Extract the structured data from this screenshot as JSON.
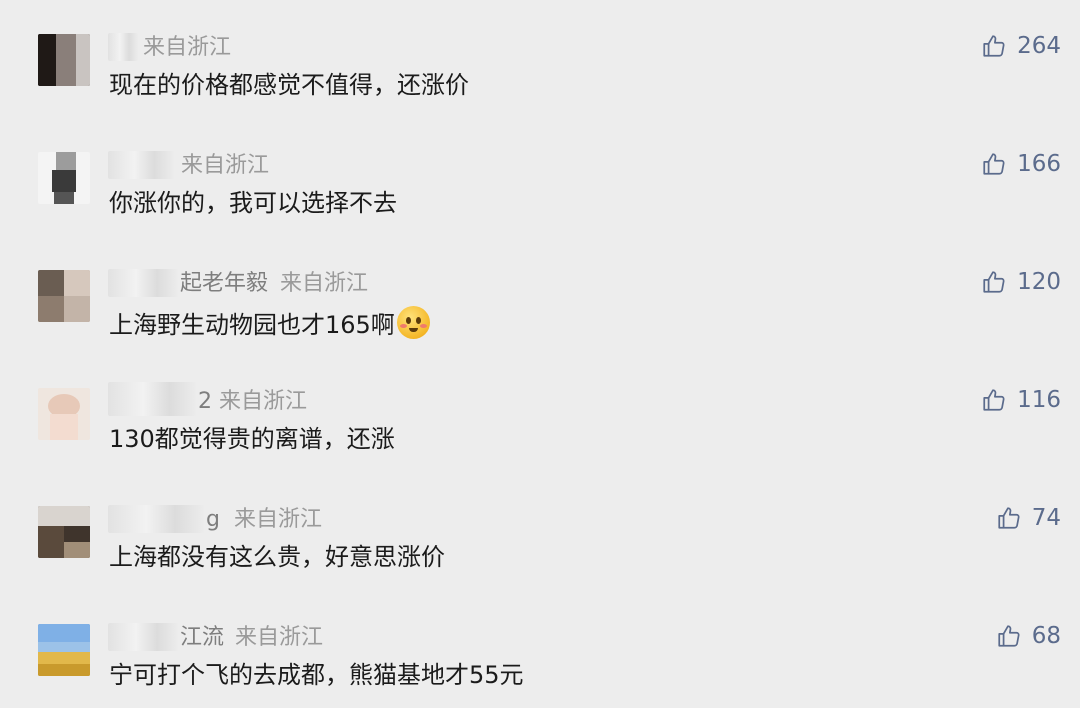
{
  "comments": [
    {
      "name_tail": "",
      "location": "来自浙江",
      "text": "现在的价格都感觉不值得，还涨价",
      "likes": "264",
      "emoji": false
    },
    {
      "name_tail": "",
      "location": "来自浙江",
      "text": "你涨你的，我可以选择不去",
      "likes": "166",
      "emoji": false
    },
    {
      "name_tail": "起老年毅",
      "location": "来自浙江",
      "text": "上海野生动物园也才165啊",
      "likes": "120",
      "emoji": true
    },
    {
      "name_tail": "2",
      "location": "来自浙江",
      "text": "130都觉得贵的离谱，还涨",
      "likes": "116",
      "emoji": false
    },
    {
      "name_tail": "g",
      "location": "来自浙江",
      "text": "上海都没有这么贵，好意思涨价",
      "likes": "74",
      "emoji": false
    },
    {
      "name_tail": "江流",
      "location": "来自浙江",
      "text": "宁可打个飞的去成都，熊猫基地才55元",
      "likes": "68",
      "emoji": false
    }
  ],
  "icons": {
    "like": "thumbs-up-icon"
  },
  "colors": {
    "background": "#ededed",
    "like": "#5b6b8c",
    "location": "#9a9a9a",
    "text": "#1b1b1b"
  }
}
